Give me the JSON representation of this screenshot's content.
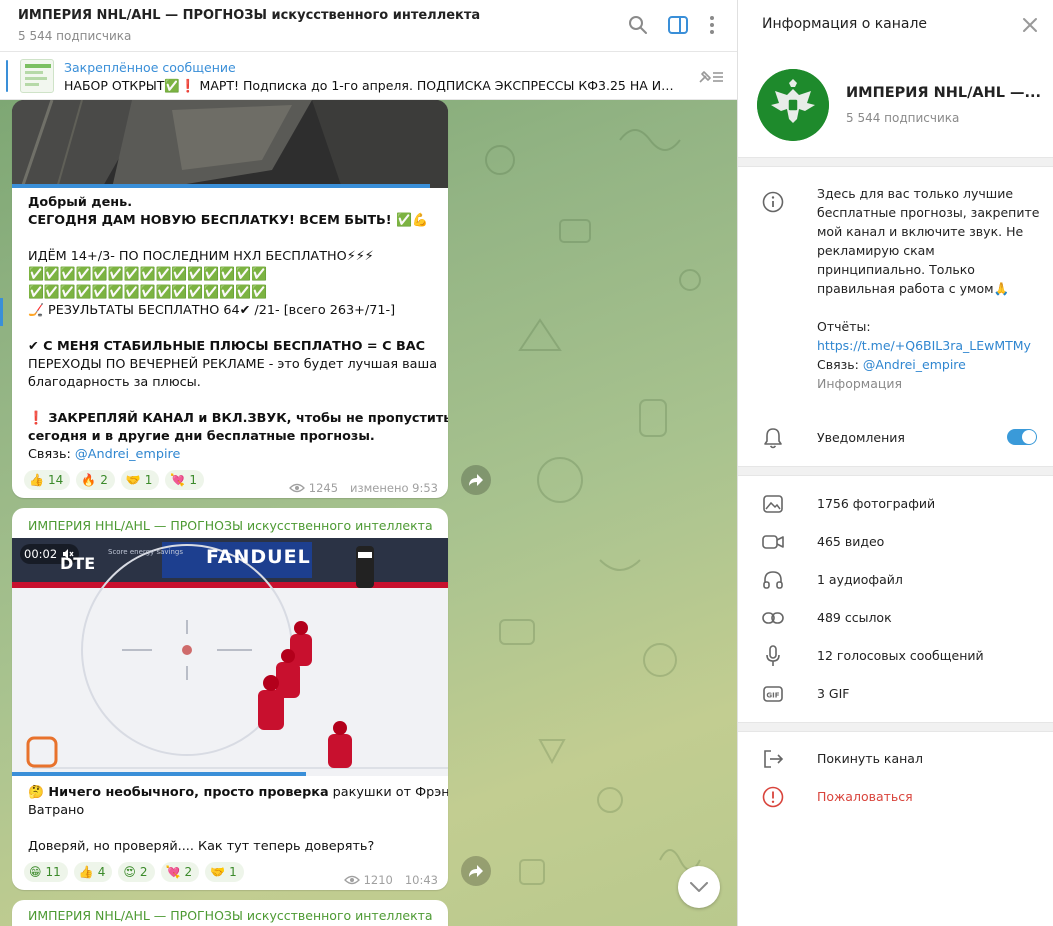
{
  "chat": {
    "title": "ИМПЕРИЯ NHL/AHL — ПРОГНОЗЫ искусственного интеллекта",
    "subscribers": "5 544 подписчика",
    "pinned": {
      "title": "Закреплённое сообщение",
      "text": "НАБОР ОТКРЫТ✅❗ МАРТ! Подписка до 1-го апреля.   ПОДПИСКА  ЭКСПРЕССЫ КФ3.25 НА ИН..."
    },
    "messages": [
      {
        "lines": [
          "Добрый день.",
          "СЕГОДНЯ ДАМ НОВУЮ БЕСПЛАТКУ! ВСЕМ БЫТЬ! ✅💪",
          "",
          "ИДЁМ 14+/3- ПО ПОСЛЕДНИМ НХЛ БЕСПЛАТНО⚡⚡⚡",
          "✅✅✅✅✅✅✅✅✅✅✅✅✅✅✅",
          "✅✅✅✅✅✅✅✅✅✅✅✅✅✅✅",
          "🏒 РЕЗУЛЬТАТЫ БЕСПЛАТНО 64✔ /21- [всего 263+/71-]",
          "",
          "✔ С МЕНЯ СТАБИЛЬНЫЕ ПЛЮСЫ БЕСПЛАТНО = С ВАС",
          "ПЕРЕХОДЫ ПО ВЕЧЕРНЕЙ РЕКЛАМЕ - это будет лучшая ваша",
          "благодарность за плюсы.",
          "",
          "❗ ЗАКРЕПЛЯЙ КАНАЛ и ВКЛ.ЗВУК, чтобы не пропустить",
          "сегодня и в другие дни бесплатные прогнозы."
        ],
        "contact_label": "Связь: ",
        "contact_link": "@Andrei_empire",
        "reactions": [
          {
            "emoji": "👍",
            "count": "14"
          },
          {
            "emoji": "🔥",
            "count": "2"
          },
          {
            "emoji": "🤝",
            "count": "1"
          },
          {
            "emoji": "💘",
            "count": "1"
          }
        ],
        "views": "1245",
        "time": "изменено 9:53"
      },
      {
        "author": "ИМПЕРИЯ НHL/AHL — ПРОГНОЗЫ искусственного интеллекта",
        "video_time": "00:02",
        "video_board_1": "FANDUEL",
        "video_board_2": "DTE",
        "video_board_3": "Score energy savings",
        "line1_bold": "🤔 Ничего необычного, просто проверка",
        "line1_rest": " ракушки от Фрэнка",
        "line2": "Ватрано",
        "line3": "Доверяй, но проверяй.... Как тут теперь доверять?",
        "reactions": [
          {
            "emoji": "😁",
            "count": "11"
          },
          {
            "emoji": "👍",
            "count": "4"
          },
          {
            "emoji": "😍",
            "count": "2"
          },
          {
            "emoji": "💘",
            "count": "2"
          },
          {
            "emoji": "🤝",
            "count": "1"
          }
        ],
        "views": "1210",
        "time": "10:43"
      },
      {
        "author": "ИМПЕРИЯ NHL/AHL — ПРОГНОЗЫ искусственного интеллекта"
      }
    ]
  },
  "info": {
    "header": "Информация о канале",
    "name": "ИМПЕРИЯ NHL/AHL —...",
    "subscribers": "5 544 подписчика",
    "description_lines": [
      "Здесь для вас только лучшие",
      "бесплатные прогнозы, закрепите",
      "мой канал и включите звук. Не",
      "рекламирую скам",
      "принципиально. Только",
      "правильная работа с умом🙏"
    ],
    "reports_label": "Отчёты:",
    "reports_link": "https://t.me/+Q6BIL3ra_LEwMTMy",
    "contact_label": "Связь: ",
    "contact_link": "@Andrei_empire",
    "info_caption": "Информация",
    "notifications": "Уведомления",
    "notifications_on": true,
    "media": [
      {
        "icon": "photo-icon",
        "label": "1756 фотографий"
      },
      {
        "icon": "video-icon",
        "label": "465 видео"
      },
      {
        "icon": "headphones-icon",
        "label": "1 аудиофайл"
      },
      {
        "icon": "link-icon",
        "label": "489 ссылок"
      },
      {
        "icon": "microphone-icon",
        "label": "12 голосовых сообщений"
      },
      {
        "icon": "gif-icon",
        "label": "3 GIF"
      }
    ],
    "leave": "Покинуть канал",
    "report": "Пожаловаться"
  },
  "colors": {
    "accent": "#3a8fd8",
    "channel_name": "#4d9a33",
    "danger": "#d9443c"
  }
}
